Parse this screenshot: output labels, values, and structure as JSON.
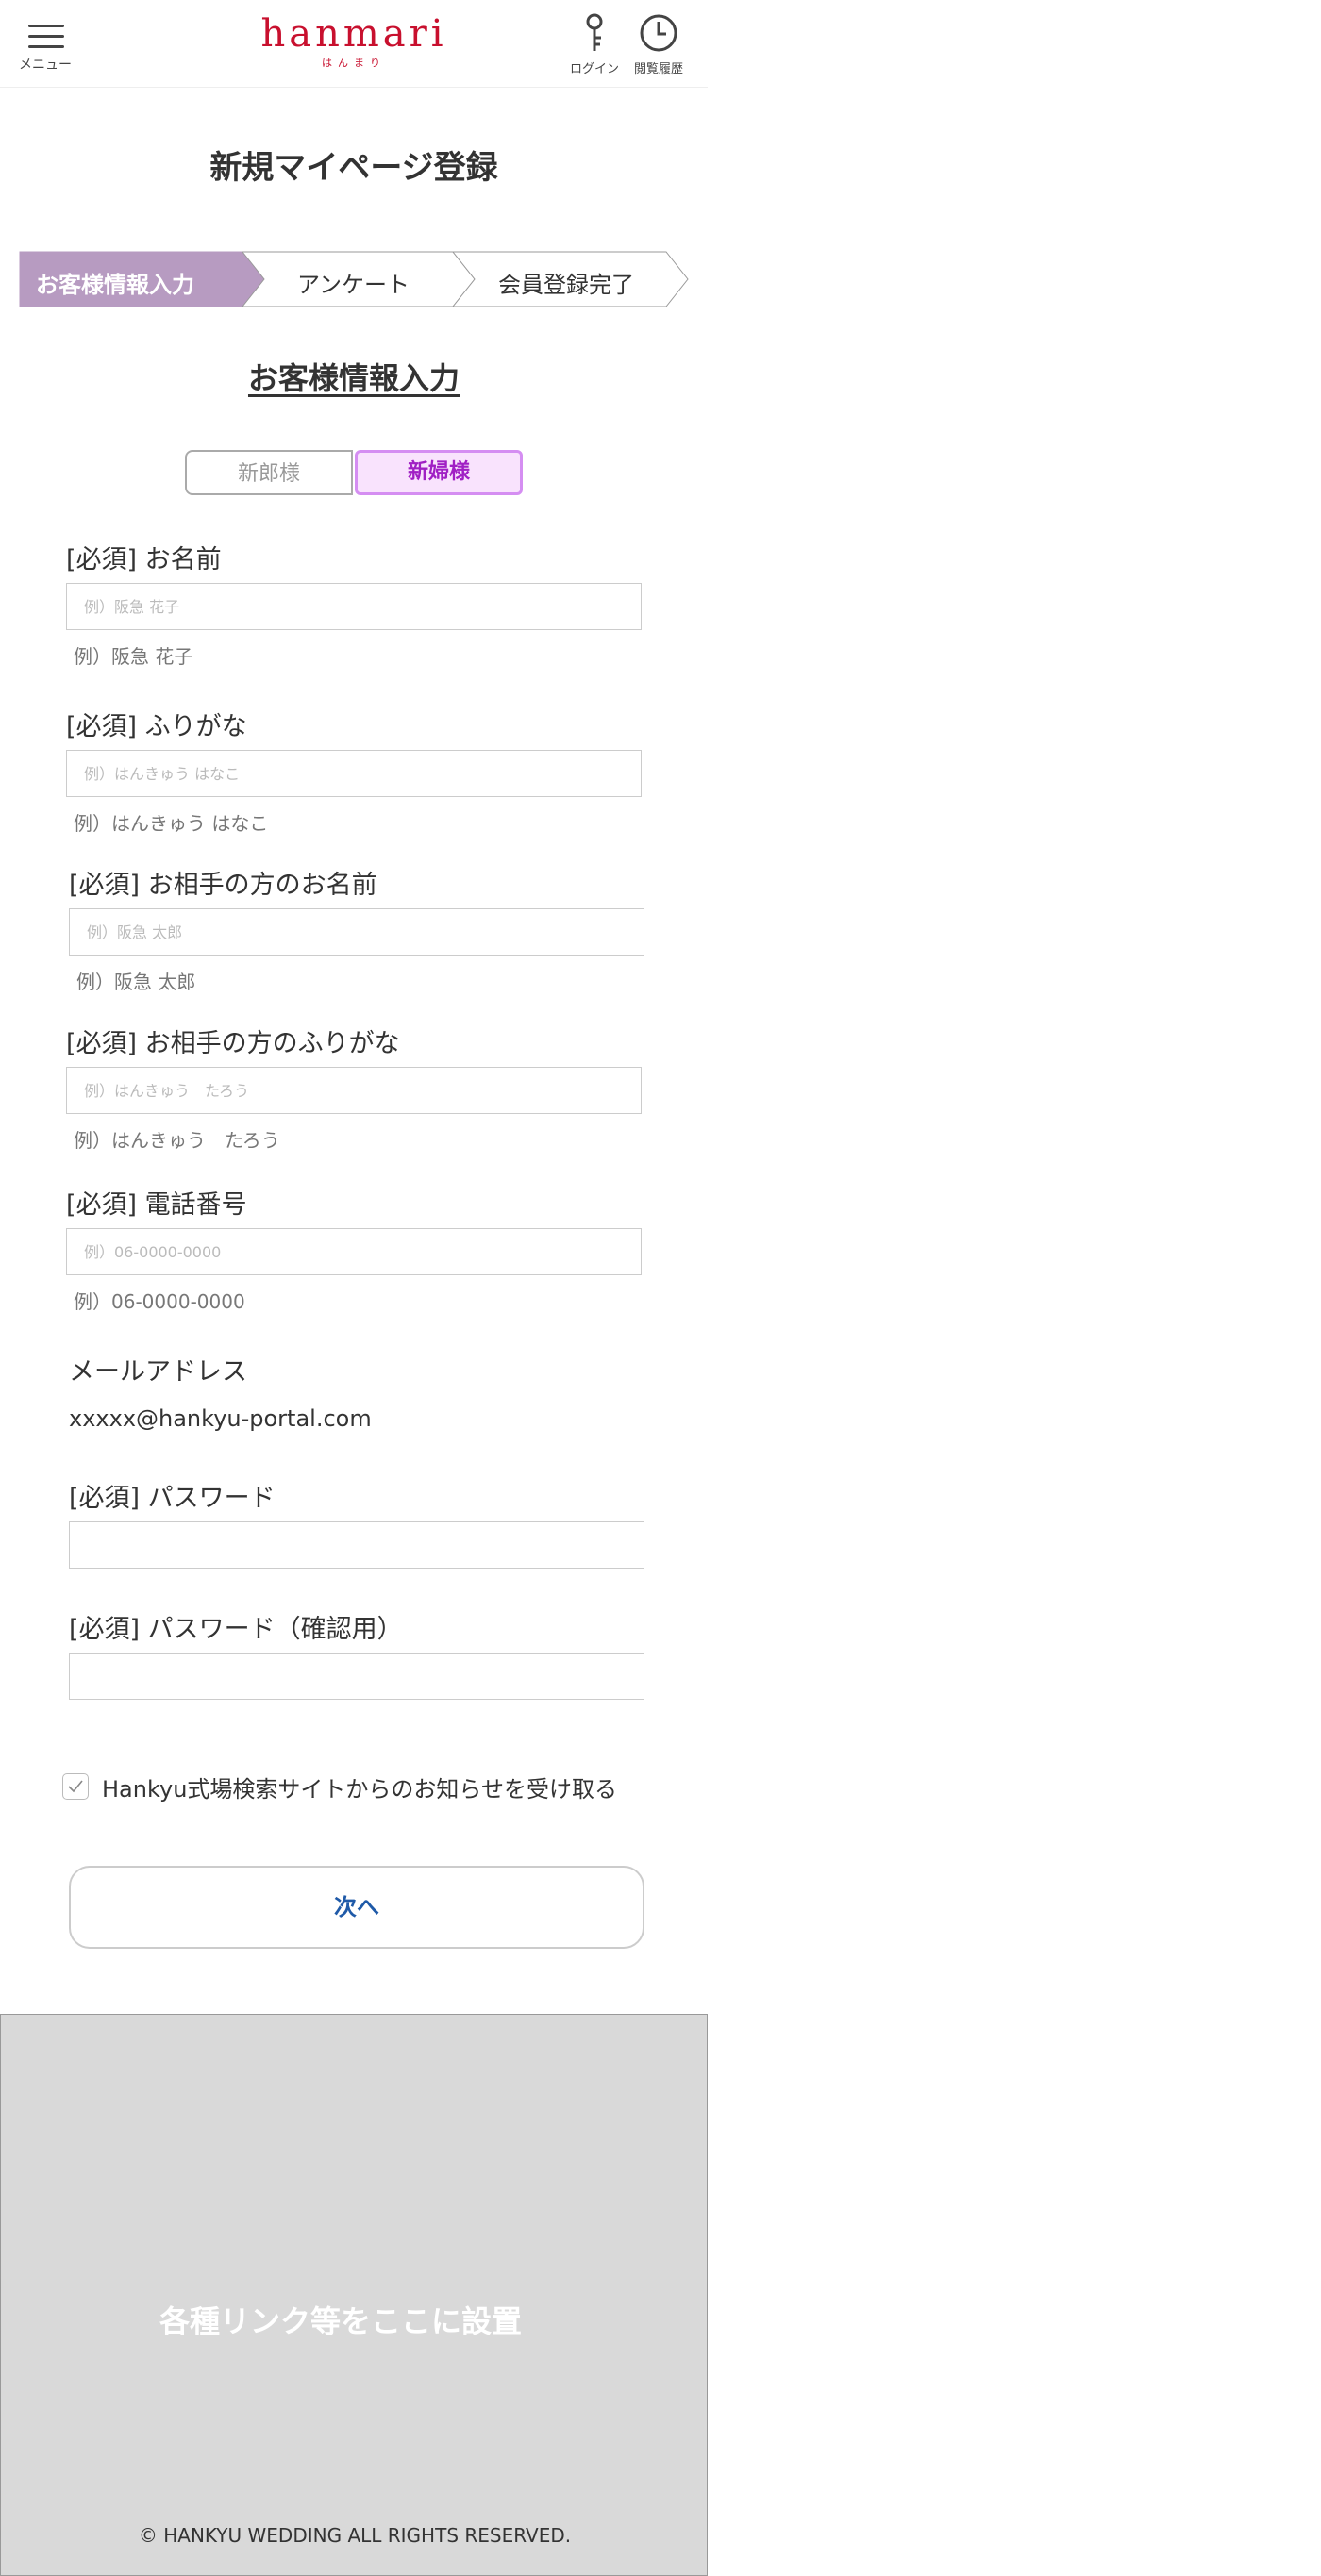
{
  "header": {
    "menu_label": "メニュー",
    "logo_text": "hanmari",
    "logo_sub": "はんまり",
    "login_label": "ログイン",
    "history_label": "閲覧履歴",
    "brand_color": "#c8102e"
  },
  "page_title": "新規マイページ登録",
  "steps": [
    {
      "label": "お客様情報入力",
      "active": true
    },
    {
      "label": "アンケート",
      "active": false
    },
    {
      "label": "会員登録完了",
      "active": false
    }
  ],
  "section_title": "お客様情報入力",
  "toggle": {
    "groom_label": "新郎様",
    "bride_label": "新婦様",
    "selected": "新婦様"
  },
  "fields": {
    "name": {
      "label": "[必須] お名前",
      "placeholder": "例）阪急 花子",
      "value": "",
      "hint": "例）阪急 花子"
    },
    "furigana": {
      "label": "[必須] ふりがな",
      "placeholder": "例）はんきゅう はなこ",
      "value": "",
      "hint": "例）はんきゅう はなこ"
    },
    "partner_name": {
      "label": "[必須] お相手の方のお名前",
      "placeholder": "例）阪急 太郎",
      "value": "",
      "hint": "例）阪急 太郎"
    },
    "partner_furigana": {
      "label": "[必須] お相手の方のふりがな",
      "placeholder": "例）はんきゅう　たろう",
      "value": "",
      "hint": "例）はんきゅう　たろう"
    },
    "phone": {
      "label": "[必須] 電話番号",
      "placeholder": "例）06-0000-0000",
      "value": "",
      "hint": "例）06-0000-0000"
    },
    "email": {
      "label": "メールアドレス",
      "value": "xxxxx@hankyu-portal.com"
    },
    "password": {
      "label": "[必須] パスワード",
      "value": ""
    },
    "password_confirm": {
      "label": "[必須] パスワード（確認用）",
      "value": ""
    }
  },
  "newsletter": {
    "label": "Hankyu式場検索サイトからのお知らせを受け取る",
    "checked": true
  },
  "next_button": "次へ",
  "footer": {
    "links_placeholder": "各種リンク等をここに設置",
    "copyright": "© HANKYU WEDDING ALL RIGHTS RESERVED."
  },
  "colors": {
    "step_active": "#b79bc1",
    "bride_border": "#d58ef2",
    "bride_bg": "#f9e3fd",
    "next_text": "#1f5aa8",
    "footer_bg": "#d9d9d9"
  }
}
